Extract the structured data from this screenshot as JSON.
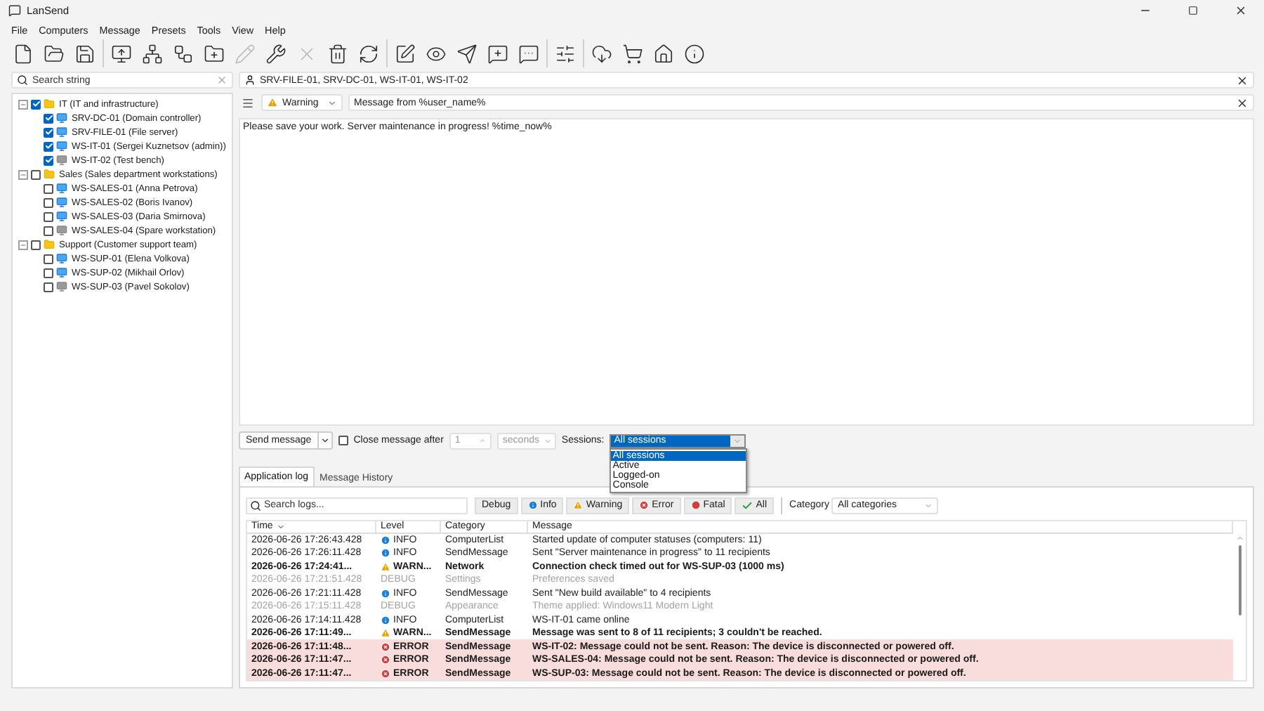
{
  "window": {
    "title": "LanSend"
  },
  "menu": [
    "File",
    "Computers",
    "Message",
    "Presets",
    "Tools",
    "View",
    "Help"
  ],
  "toolbar": [
    [
      {
        "disabled": false
      },
      {
        "disabled": false
      },
      {
        "disabled": false
      }
    ],
    [
      {
        "disabled": false
      },
      {
        "disabled": false
      },
      {
        "disabled": false
      },
      {
        "disabled": false
      },
      {
        "disabled": true
      },
      {
        "disabled": false
      },
      {
        "disabled": true
      },
      {
        "disabled": false
      },
      {
        "disabled": false
      }
    ],
    [
      {
        "disabled": false
      },
      {
        "disabled": false
      },
      {
        "disabled": false
      },
      {
        "disabled": false
      },
      {
        "disabled": false
      }
    ],
    [
      {
        "disabled": false
      }
    ],
    [
      {
        "disabled": false
      },
      {
        "disabled": false
      },
      {
        "disabled": false
      },
      {
        "disabled": false
      }
    ]
  ],
  "search": {
    "placeholder": "Search string"
  },
  "tree": [
    {
      "label": "IT (IT and infrastructure)",
      "checked": true,
      "expanded": true,
      "children": [
        {
          "label": "SRV-DC-01 (Domain controller)",
          "checked": true,
          "online": true
        },
        {
          "label": "SRV-FILE-01 (File server)",
          "checked": true,
          "online": true
        },
        {
          "label": "WS-IT-01 (Sergei Kuznetsov (admin))",
          "checked": true,
          "online": true
        },
        {
          "label": "WS-IT-02 (Test bench)",
          "checked": true,
          "online": false
        }
      ]
    },
    {
      "label": "Sales (Sales department workstations)",
      "checked": false,
      "expanded": true,
      "children": [
        {
          "label": "WS-SALES-01 (Anna Petrova)",
          "checked": false,
          "online": true
        },
        {
          "label": "WS-SALES-02 (Boris Ivanov)",
          "checked": false,
          "online": true
        },
        {
          "label": "WS-SALES-03 (Daria Smirnova)",
          "checked": false,
          "online": true
        },
        {
          "label": "WS-SALES-04 (Spare workstation)",
          "checked": false,
          "online": false
        }
      ]
    },
    {
      "label": "Support (Customer support team)",
      "checked": false,
      "expanded": true,
      "children": [
        {
          "label": "WS-SUP-01 (Elena Volkova)",
          "checked": false,
          "online": true
        },
        {
          "label": "WS-SUP-02 (Mikhail Orlov)",
          "checked": false,
          "online": true
        },
        {
          "label": "WS-SUP-03 (Pavel Sokolov)",
          "checked": false,
          "online": false
        }
      ]
    }
  ],
  "recipients": "SRV-FILE-01, SRV-DC-01, WS-IT-01, WS-IT-02",
  "message": {
    "level": "Warning",
    "title": "Message from %user_name%",
    "body": "Please save your work. Server maintenance in progress! %time_now%"
  },
  "send": {
    "button": "Send message",
    "close_after": {
      "label": "Close message after",
      "checked": false,
      "value": "1",
      "unit": "seconds"
    },
    "sessions": {
      "label": "Sessions:",
      "value": "All sessions",
      "options": [
        {
          "label": "All sessions",
          "selected": true
        },
        {
          "label": "Active",
          "selected": false
        },
        {
          "label": "Logged-on",
          "selected": false
        },
        {
          "label": "Console",
          "selected": false
        }
      ]
    }
  },
  "log_tabs": [
    {
      "label": "Application log",
      "selected": true
    },
    {
      "label": "Message History",
      "selected": false
    }
  ],
  "log_search": {
    "placeholder": "Search logs..."
  },
  "filters": [
    {
      "label": "Debug",
      "kind": "debug"
    },
    {
      "label": "Info",
      "kind": "info"
    },
    {
      "label": "Warning",
      "kind": "warning"
    },
    {
      "label": "Error",
      "kind": "error"
    },
    {
      "label": "Fatal",
      "kind": "fatal"
    },
    {
      "label": "All",
      "kind": "all"
    }
  ],
  "category": {
    "label": "Category",
    "value": "All categories"
  },
  "log": {
    "columns": [
      "Time",
      "Level",
      "Category",
      "Message"
    ],
    "rows": [
      {
        "kind": "info",
        "time": "2026-06-26 17:26:43.428",
        "level": "INFO",
        "category": "ComputerList",
        "message": "Started update of computer statuses (computers: 11)"
      },
      {
        "kind": "info",
        "time": "2026-06-26 17:26:11.428",
        "level": "INFO",
        "category": "SendMessage",
        "message": "Sent \"Server maintenance in progress\" to 11 recipients"
      },
      {
        "kind": "warning",
        "time": "2026-06-26 17:24:41...",
        "level": "WARN...",
        "category": "Network",
        "message": "Connection check timed out for WS-SUP-03 (1000 ms)"
      },
      {
        "kind": "debug",
        "time": "2026-06-26 17:21:51.428",
        "level": "DEBUG",
        "category": "Settings",
        "message": "Preferences saved"
      },
      {
        "kind": "info",
        "time": "2026-06-26 17:21:11.428",
        "level": "INFO",
        "category": "SendMessage",
        "message": "Sent \"New build available\" to 4 recipients"
      },
      {
        "kind": "debug",
        "time": "2026-06-26 17:15:11.428",
        "level": "DEBUG",
        "category": "Appearance",
        "message": "Theme applied: Windows11 Modern Light"
      },
      {
        "kind": "info",
        "time": "2026-06-26 17:14:11.428",
        "level": "INFO",
        "category": "ComputerList",
        "message": "WS-IT-01 came online"
      },
      {
        "kind": "warning",
        "time": "2026-06-26 17:11:49...",
        "level": "WARN...",
        "category": "SendMessage",
        "message": "Message was sent to 8 of 11 recipients; 3 couldn't be reached."
      },
      {
        "kind": "error",
        "time": "2026-06-26 17:11:48...",
        "level": "ERROR",
        "category": "SendMessage",
        "message": "WS-IT-02: Message could not be sent. Reason: The device is disconnected or powered off."
      },
      {
        "kind": "error",
        "time": "2026-06-26 17:11:47...",
        "level": "ERROR",
        "category": "SendMessage",
        "message": "WS-SALES-04: Message could not be sent. Reason: The device is disconnected or powered off."
      },
      {
        "kind": "error",
        "time": "2026-06-26 17:11:47...",
        "level": "ERROR",
        "category": "SendMessage",
        "message": "WS-SUP-03: Message could not be sent. Reason: The device is disconnected or powered off."
      }
    ]
  }
}
